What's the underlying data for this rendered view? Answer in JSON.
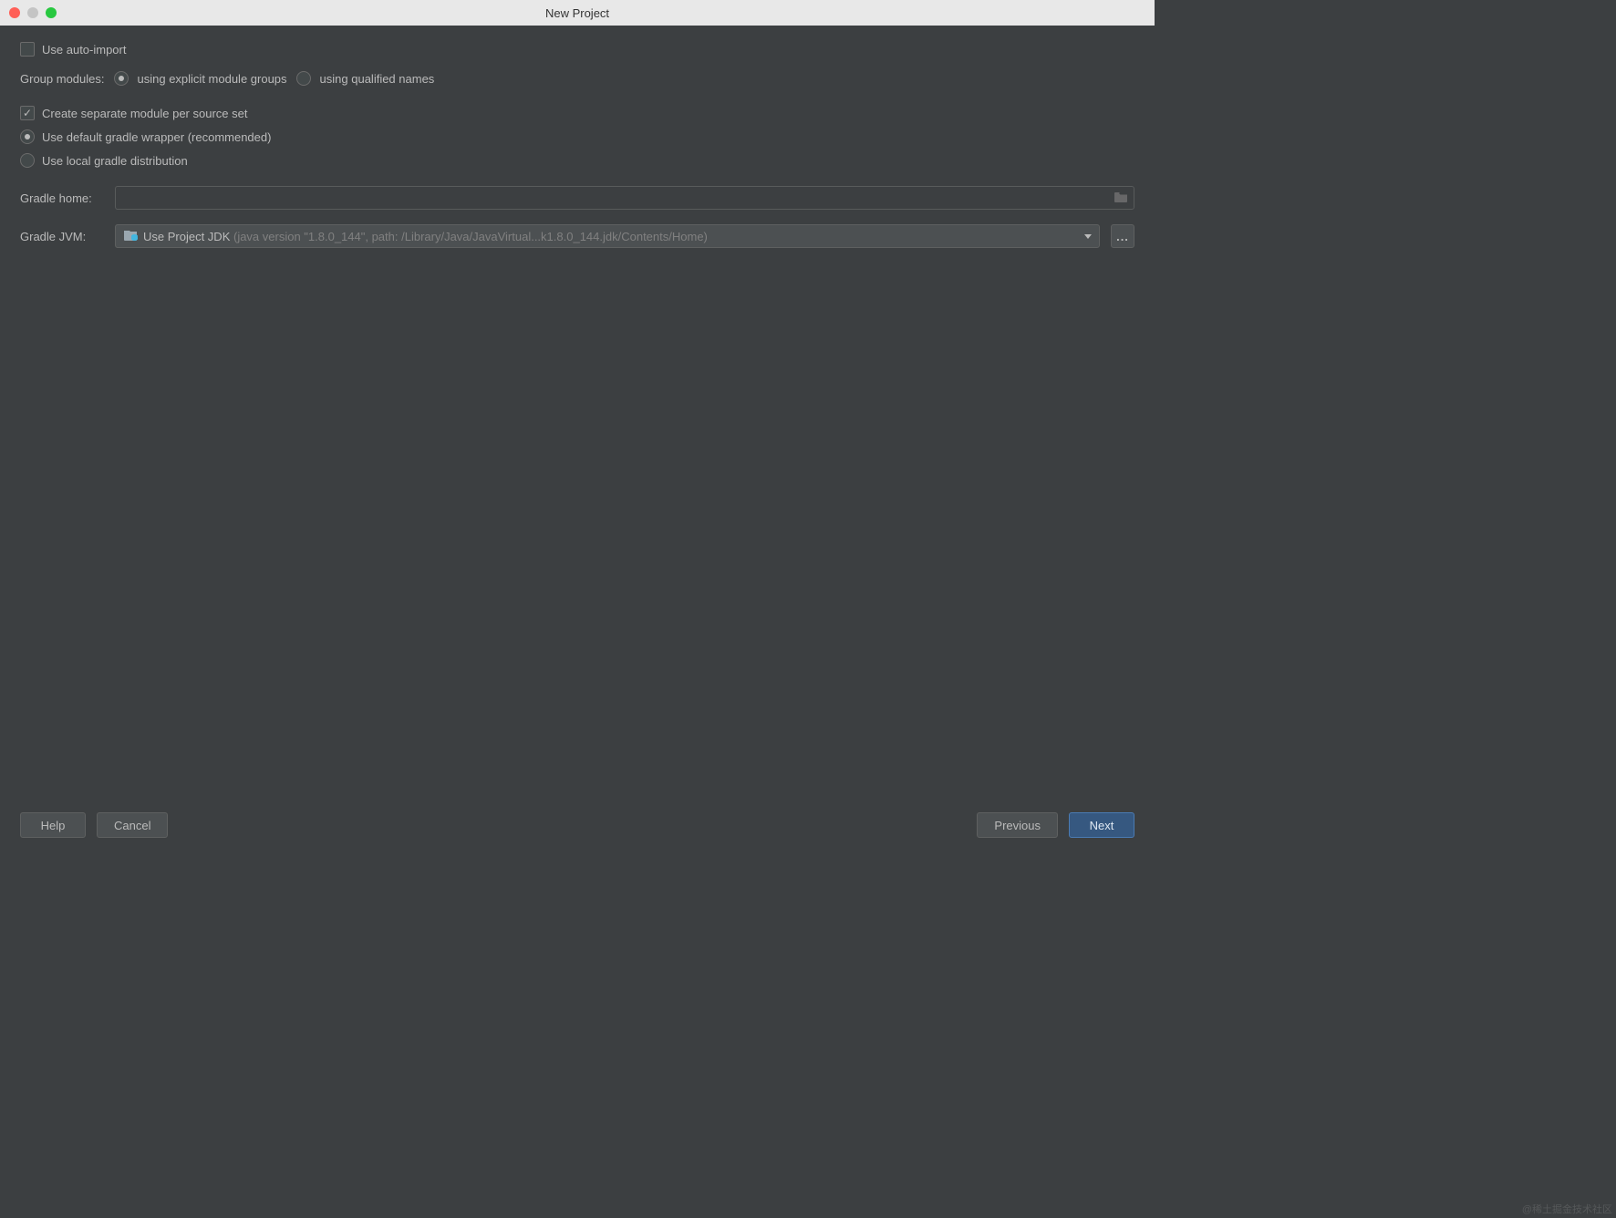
{
  "window": {
    "title": "New Project"
  },
  "options": {
    "auto_import_label": "Use auto-import",
    "auto_import_checked": false,
    "group_modules_label": "Group modules:",
    "group_option_explicit": "using explicit module groups",
    "group_option_qualified": "using qualified names",
    "separate_module_label": "Create separate module per source set",
    "separate_module_checked": true,
    "wrapper_default_label": "Use default gradle wrapper (recommended)",
    "wrapper_local_label": "Use local gradle distribution"
  },
  "form": {
    "gradle_home_label": "Gradle home:",
    "gradle_home_value": "",
    "gradle_jvm_label": "Gradle JVM:",
    "gradle_jvm_selected": "Use Project JDK",
    "gradle_jvm_detail": " (java version \"1.8.0_144\", path: /Library/Java/JavaVirtual...k1.8.0_144.jdk/Contents/Home)"
  },
  "buttons": {
    "help": "Help",
    "cancel": "Cancel",
    "previous": "Previous",
    "next": "Next",
    "ellipsis": "..."
  },
  "watermark": "@稀土掘金技术社区"
}
